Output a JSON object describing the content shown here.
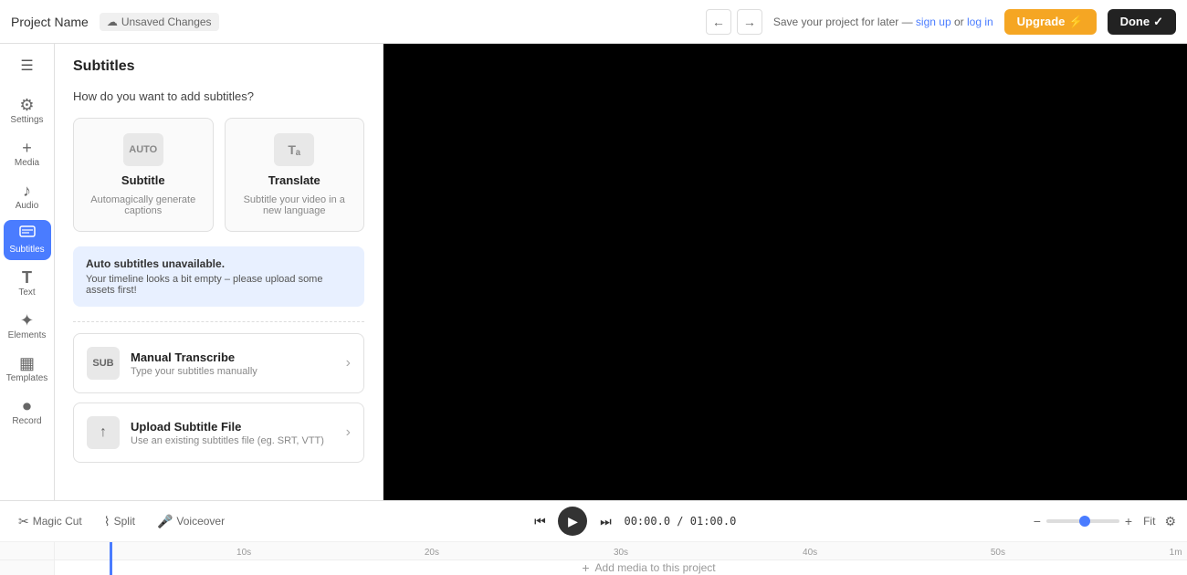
{
  "topbar": {
    "project_name": "Project Name",
    "unsaved_label": "Unsaved Changes",
    "save_text": "Save your project for later —",
    "sign_up": "sign up",
    "or_text": "or",
    "log_in": "log in",
    "upgrade_label": "Upgrade",
    "upgrade_icon": "⚡",
    "done_label": "Done",
    "done_icon": "✓"
  },
  "sidebar": {
    "menu_icon": "☰",
    "items": [
      {
        "id": "settings",
        "icon": "⚙",
        "label": "Settings",
        "active": false
      },
      {
        "id": "media",
        "icon": "+",
        "label": "Media",
        "active": false
      },
      {
        "id": "audio",
        "icon": "♪",
        "label": "Audio",
        "active": false
      },
      {
        "id": "subtitles",
        "icon": "T",
        "label": "Subtitles",
        "active": true
      },
      {
        "id": "text",
        "icon": "T",
        "label": "Text",
        "active": false
      },
      {
        "id": "elements",
        "icon": "✦",
        "label": "Elements",
        "active": false
      },
      {
        "id": "templates",
        "icon": "▦",
        "label": "Templates",
        "active": false
      },
      {
        "id": "record",
        "icon": "⏺",
        "label": "Record",
        "active": false
      }
    ]
  },
  "panel": {
    "title": "Subtitles",
    "question": "How do you want to add subtitles?",
    "options": [
      {
        "id": "subtitle",
        "icon_text": "AUTO",
        "title": "Subtitle",
        "desc": "Automagically generate captions"
      },
      {
        "id": "translate",
        "icon_text": "Tₐ",
        "title": "Translate",
        "desc": "Subtitle your video in a new language"
      }
    ],
    "alert": {
      "title": "Auto subtitles unavailable.",
      "desc": "Your timeline looks a bit empty – please upload some assets first!"
    },
    "actions": [
      {
        "id": "manual-transcribe",
        "icon_text": "SUB",
        "title": "Manual Transcribe",
        "desc": "Type your subtitles manually"
      },
      {
        "id": "upload-subtitle",
        "icon_text": "↑",
        "title": "Upload Subtitle File",
        "desc": "Use an existing subtitles file (eg. SRT, VTT)"
      }
    ]
  },
  "timeline": {
    "magic_cut_label": "Magic Cut",
    "split_label": "Split",
    "voiceover_label": "Voiceover",
    "current_time": "00:00.0",
    "total_time": "01:00.0",
    "fit_label": "Fit",
    "add_media_label": "Add media to this project",
    "ruler_labels": [
      "10s",
      "20s",
      "30s",
      "40s",
      "50s",
      "1m"
    ]
  }
}
